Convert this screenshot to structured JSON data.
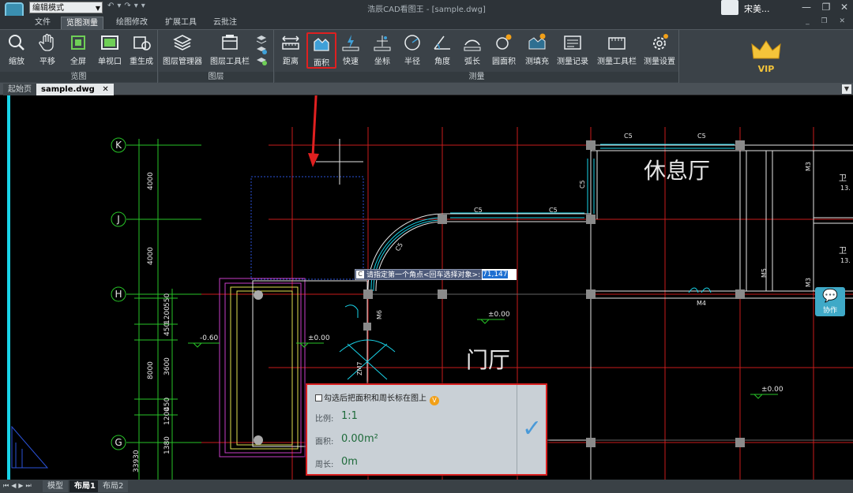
{
  "titlebar": {
    "mode": "编辑模式",
    "title": "浩辰CAD看图王 - [sample.dwg]",
    "user": "宋美..."
  },
  "menu": [
    "文件",
    "览图测量",
    "绘图修改",
    "扩展工具",
    "云批注"
  ],
  "ribbon": {
    "view_group": {
      "label": "览图",
      "buttons": [
        {
          "label": "缩放",
          "icon": "zoom-icon"
        },
        {
          "label": "平移",
          "icon": "pan-hand-icon"
        },
        {
          "label": "全屏",
          "icon": "fullscreen-icon"
        },
        {
          "label": "单视口",
          "icon": "single-viewport-icon"
        },
        {
          "label": "重生成",
          "icon": "regenerate-icon"
        }
      ]
    },
    "layer_group": {
      "label": "图层",
      "buttons": [
        {
          "label": "图层管理器",
          "icon": "layer-manager-icon"
        },
        {
          "label": "图层工具栏",
          "icon": "layer-toolbar-icon"
        }
      ]
    },
    "measure_group": {
      "label": "测量",
      "buttons": [
        {
          "label": "距离",
          "icon": "distance-icon"
        },
        {
          "label": "面积",
          "icon": "area-icon"
        },
        {
          "label": "快速",
          "icon": "quick-measure-icon"
        },
        {
          "label": "坐标",
          "icon": "coordinate-icon"
        },
        {
          "label": "半径",
          "icon": "radius-icon"
        },
        {
          "label": "角度",
          "icon": "angle-icon"
        },
        {
          "label": "弧长",
          "icon": "arc-length-icon"
        },
        {
          "label": "圆面积",
          "icon": "circle-area-icon"
        },
        {
          "label": "测填充",
          "icon": "measure-hatch-icon"
        },
        {
          "label": "测量记录",
          "icon": "measure-record-icon"
        },
        {
          "label": "测量工具栏",
          "icon": "measure-toolbar-icon"
        },
        {
          "label": "测量设置",
          "icon": "measure-settings-icon"
        }
      ]
    },
    "vip": "VIP"
  },
  "doc_tabs": [
    "起始页",
    "sample.dwg"
  ],
  "drawing": {
    "axis_labels": [
      "K",
      "J",
      "H",
      "G"
    ],
    "dims": [
      "4000",
      "4000",
      "8000",
      "550",
      "1200",
      "450",
      "3600",
      "1200",
      "450",
      "1380",
      "33930"
    ],
    "levels": [
      "-0.60",
      "±0.00",
      "±0.00",
      "±0.00"
    ],
    "rooms": [
      "休息厅",
      "门厅"
    ],
    "tags": [
      "C5",
      "C5",
      "C5",
      "C5",
      "C5",
      "C5",
      "M3",
      "M3",
      "M4",
      "M5",
      "M6",
      "ZM7",
      "卫",
      "13.",
      "卫",
      "13."
    ]
  },
  "prompt": {
    "text": "请指定第一个角点<回车选择对象>:",
    "value": "71,147"
  },
  "panel": {
    "checkbox": "勾选后把面积和周长标在图上",
    "scale_label": "比例:",
    "scale_value": "1:1",
    "area_label": "面积:",
    "area_value": "0.00m²",
    "perim_label": "周长:",
    "perim_value": "0m"
  },
  "collab": "协作",
  "bottom_tabs": [
    "模型",
    "布局1",
    "布局2"
  ]
}
